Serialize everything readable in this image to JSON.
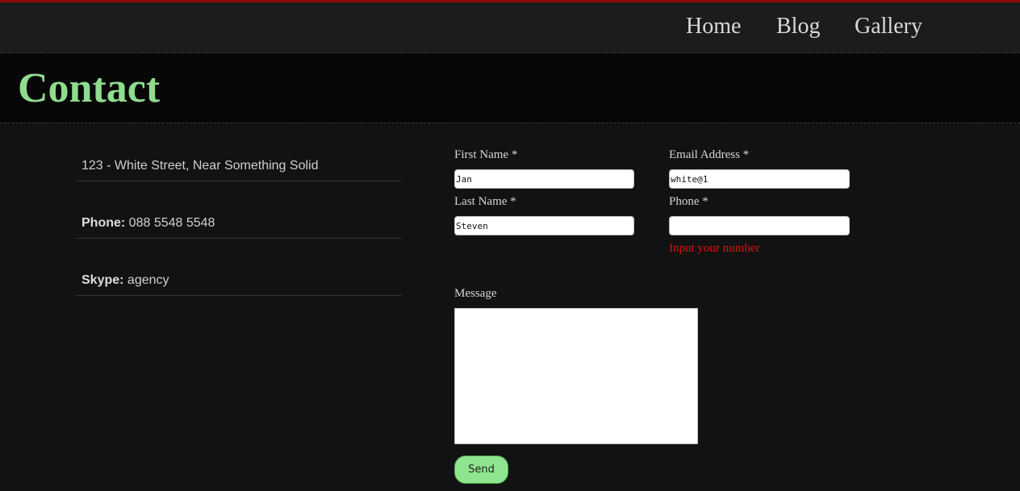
{
  "nav": {
    "items": [
      {
        "label": "Home"
      },
      {
        "label": "Blog"
      },
      {
        "label": "Gallery"
      }
    ]
  },
  "header": {
    "title": "Contact"
  },
  "contact_info": {
    "address": "123 - White Street, Near Something Solid",
    "phone_label": "Phone:",
    "phone_value": "088 5548 5548",
    "skype_label": "Skype:",
    "skype_value": "agency"
  },
  "form": {
    "first_name": {
      "label": "First Name *",
      "value": "Jan"
    },
    "last_name": {
      "label": "Last Name *",
      "value": "Steven"
    },
    "email": {
      "label": "Email Address *",
      "value": "white@1"
    },
    "phone": {
      "label": "Phone *",
      "value": "",
      "error": "Input your number"
    },
    "message": {
      "label": "Message",
      "value": ""
    },
    "send_label": "Send"
  },
  "colors": {
    "accent": "#8fdc8f",
    "top_rule": "#8b0b0b",
    "error": "#e01010"
  }
}
